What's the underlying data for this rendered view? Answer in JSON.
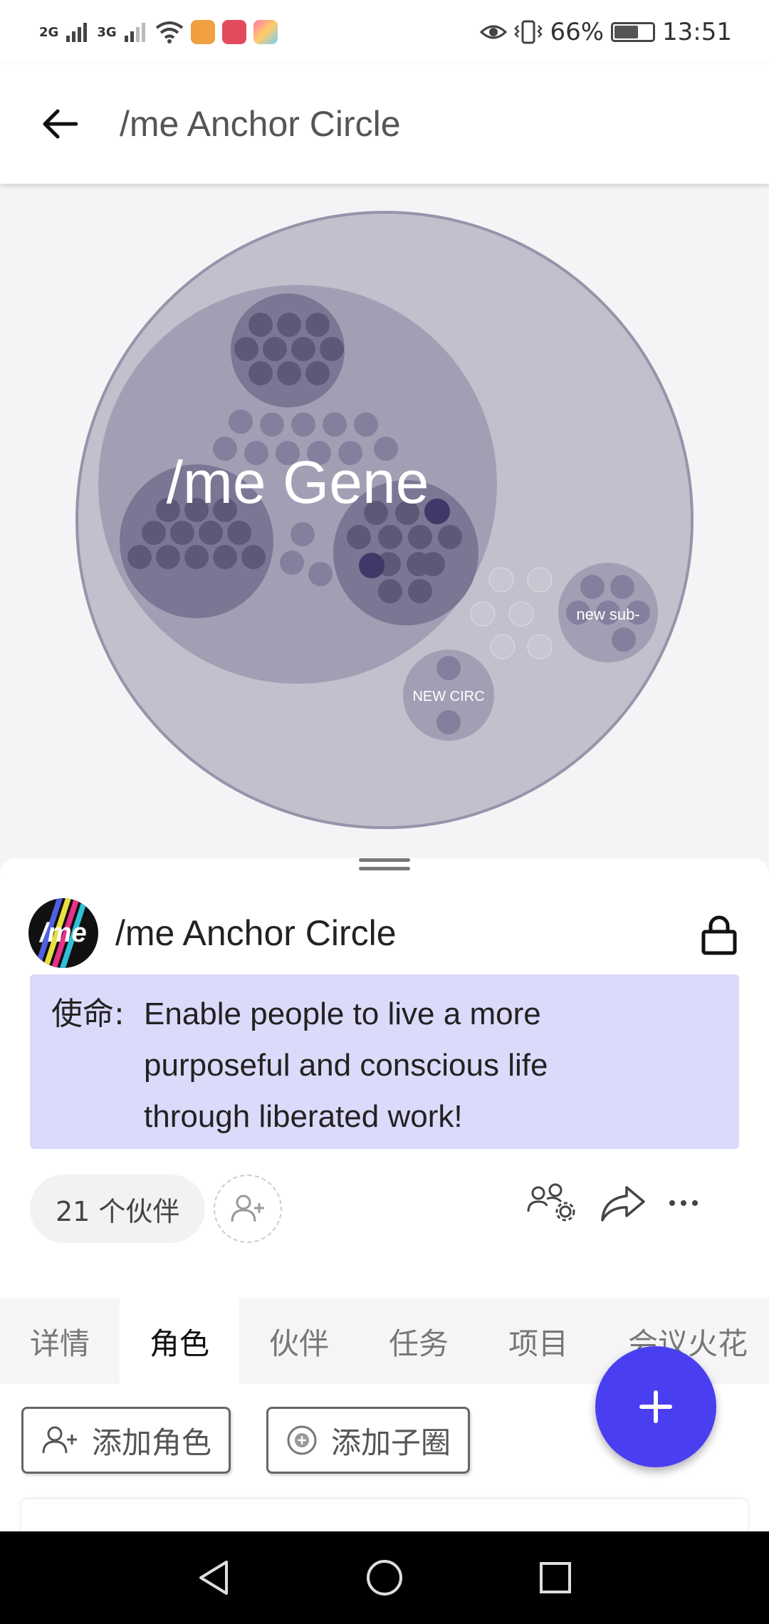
{
  "status_bar": {
    "signal_1": "2G",
    "signal_2": "3G",
    "battery_percent": "66%",
    "battery_level": 0.66,
    "time": "13:51"
  },
  "app_bar": {
    "title": "/me Anchor Circle"
  },
  "visualization": {
    "main_label": "/me Gene",
    "sub_circle_1": "new sub-",
    "sub_circle_2": "NEW CIRC"
  },
  "circle": {
    "logo_text": "/me",
    "name": "/me Anchor Circle",
    "mission_label": "使命:",
    "mission_lines": [
      "Enable people to live a more",
      "purposeful and conscious life",
      "through liberated work!"
    ],
    "members_count": "21 个伙伴"
  },
  "tabs": [
    {
      "label": "详情"
    },
    {
      "label": "角色"
    },
    {
      "label": "伙伴"
    },
    {
      "label": "任务"
    },
    {
      "label": "项目"
    },
    {
      "label": "会议火花"
    }
  ],
  "actions": {
    "add_role": "添加角色",
    "add_subcircle": "添加子圈"
  },
  "colors": {
    "accent": "#4a3ff0",
    "mission_bg": "#dcdafa",
    "outer_circle": "#c2c0cc"
  }
}
